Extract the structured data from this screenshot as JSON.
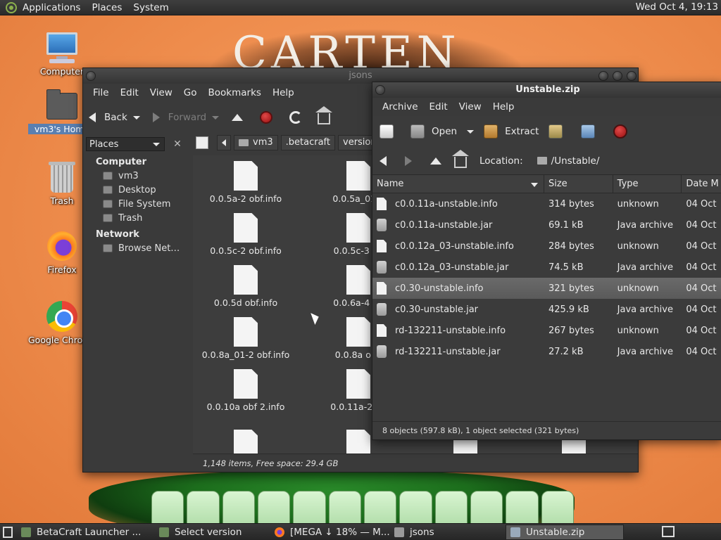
{
  "top_panel": {
    "menus": [
      "Applications",
      "Places",
      "System"
    ],
    "clock": "Wed Oct  4, 19:13"
  },
  "wallpaper": {
    "text": "CARTEN OF"
  },
  "desktop_icons": [
    {
      "label": "Computer",
      "icon": "computer-icon"
    },
    {
      "label": "vm3's Home",
      "icon": "home-folder-icon"
    },
    {
      "label": "Trash",
      "icon": "trash-icon"
    },
    {
      "label": "Firefox",
      "icon": "firefox-icon"
    },
    {
      "label": "Google Chrome",
      "icon": "chrome-icon"
    }
  ],
  "jsons_window": {
    "title": "jsons",
    "menus": [
      "File",
      "Edit",
      "View",
      "Go",
      "Bookmarks",
      "Help"
    ],
    "toolbar": {
      "back": "Back",
      "forward": "Forward"
    },
    "sidebar": {
      "combo": "Places",
      "sections": [
        {
          "title": "Computer",
          "items": [
            "vm3",
            "Desktop",
            "File System",
            "Trash"
          ]
        },
        {
          "title": "Network",
          "items": [
            "Browse Net…"
          ]
        }
      ]
    },
    "breadcrumbs": [
      "vm3",
      ".betacraft",
      "versions"
    ],
    "files": [
      "0.0.5a-2 obf.info",
      "0.0.5a_01 o",
      "0.0.5c-2 obf.info",
      "0.0.5c-3 ob",
      "0.0.5d obf.info",
      "0.0.6a-4 ob",
      "0.0.8a_01-2 obf.info",
      "0.0.8a obf.",
      "0.0.10a obf 2.info",
      "0.0.11a-2 ob"
    ],
    "status": "1,148 items, Free space: 29.4 GB"
  },
  "zip_window": {
    "title": "Unstable.zip",
    "menus": [
      "Archive",
      "Edit",
      "View",
      "Help"
    ],
    "toolbar": {
      "open": "Open",
      "extract": "Extract"
    },
    "location_label": "Location:",
    "location_value": "/Unstable/",
    "columns": [
      "Name",
      "Size",
      "Type",
      "Date M"
    ],
    "rows": [
      {
        "name": "c0.0.11a-unstable.info",
        "size": "314 bytes",
        "type": "unknown",
        "date": "04 Oct",
        "kind": "info"
      },
      {
        "name": "c0.0.11a-unstable.jar",
        "size": "69.1 kB",
        "type": "Java archive",
        "date": "04 Oct",
        "kind": "jar"
      },
      {
        "name": "c0.0.12a_03-unstable.info",
        "size": "284 bytes",
        "type": "unknown",
        "date": "04 Oct",
        "kind": "info"
      },
      {
        "name": "c0.0.12a_03-unstable.jar",
        "size": "74.5 kB",
        "type": "Java archive",
        "date": "04 Oct",
        "kind": "jar"
      },
      {
        "name": "c0.30-unstable.info",
        "size": "321 bytes",
        "type": "unknown",
        "date": "04 Oct",
        "kind": "info",
        "selected": true
      },
      {
        "name": "c0.30-unstable.jar",
        "size": "425.9 kB",
        "type": "Java archive",
        "date": "04 Oct",
        "kind": "jar"
      },
      {
        "name": "rd-132211-unstable.info",
        "size": "267 bytes",
        "type": "unknown",
        "date": "04 Oct",
        "kind": "info"
      },
      {
        "name": "rd-132211-unstable.jar",
        "size": "27.2 kB",
        "type": "Java archive",
        "date": "04 Oct",
        "kind": "jar"
      }
    ],
    "status": "8 objects (597.8 kB), 1 object selected (321 bytes)"
  },
  "taskbar": [
    {
      "label": "BetaCraft Launcher ...",
      "active": false
    },
    {
      "label": "Select version",
      "active": false
    },
    {
      "label": "[MEGA ↓ 18% — M...",
      "active": false
    },
    {
      "label": "jsons",
      "active": false
    },
    {
      "label": "Unstable.zip",
      "active": true
    }
  ]
}
